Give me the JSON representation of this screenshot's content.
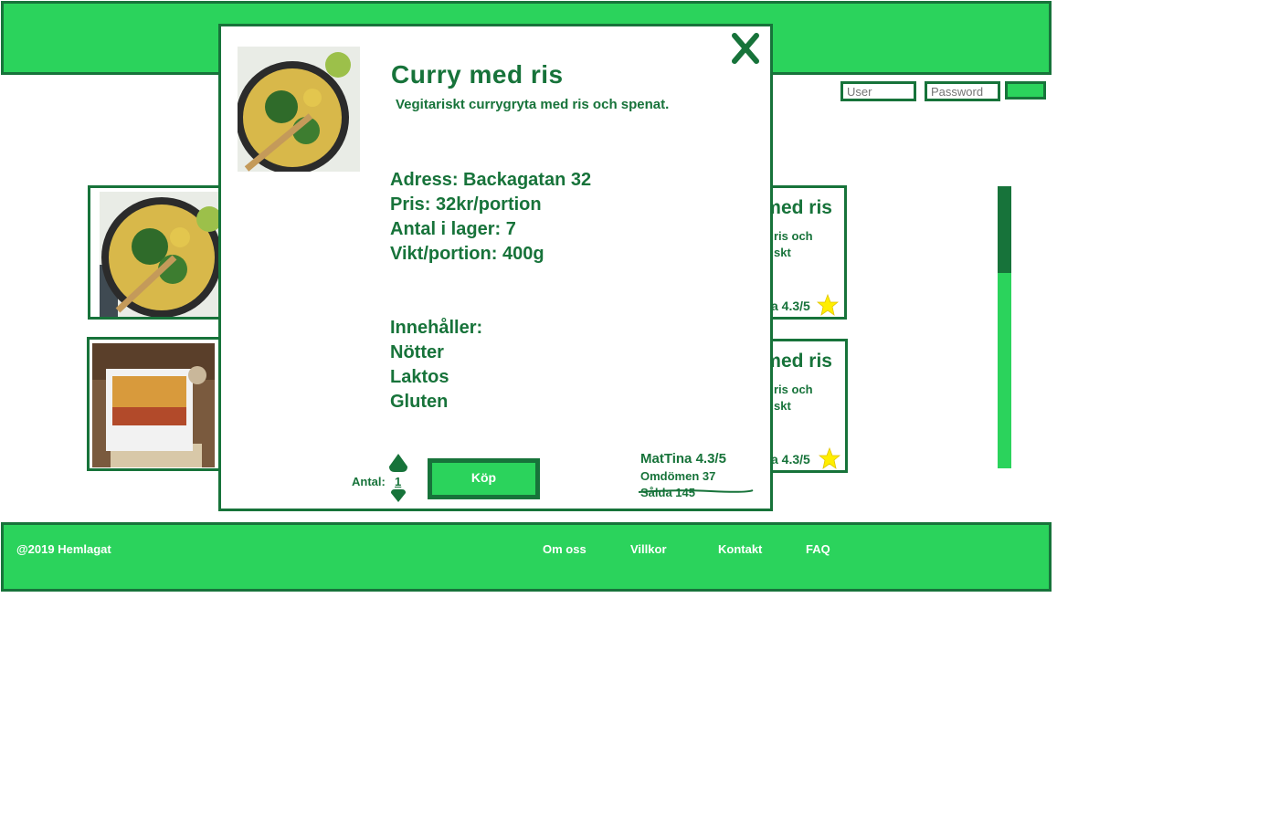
{
  "login": {
    "user_placeholder": "User",
    "password_placeholder": "Password"
  },
  "cards": [
    {
      "title": "Curry med ris",
      "desc_line1": "ris och",
      "desc_line2": "skt",
      "rating": "a 4.3/5"
    },
    {
      "title": "Curry med ris",
      "desc_line1": "ris och",
      "desc_line2": "skt",
      "rating": "a 4.3/5"
    }
  ],
  "modal": {
    "title": "Curry med ris",
    "description": "Vegitariskt currygryta med ris och spenat.",
    "address": "Adress: Backagatan 32",
    "price": "Pris: 32kr/portion",
    "stock": "Antal i lager: 7",
    "weight": "Vikt/portion: 400g",
    "contains_label": "Innehåller:",
    "allergens": [
      "Nötter",
      "Laktos",
      "Gluten"
    ],
    "quantity_label": "Antal:",
    "quantity_value": "1",
    "buy_label": "Köp",
    "seller": "MatTina 4.3/5",
    "reviews": "Omdömen 37",
    "sold": "Sålda 145",
    "close_glyph": "X"
  },
  "footer": {
    "copyright": "@2019 Hemlagat",
    "links": [
      "Om oss",
      "Villkor",
      "Kontakt",
      "FAQ"
    ]
  },
  "colors": {
    "brand_green": "#2bd35c",
    "dark_green": "#17733a",
    "star_yellow": "#ffee00"
  }
}
